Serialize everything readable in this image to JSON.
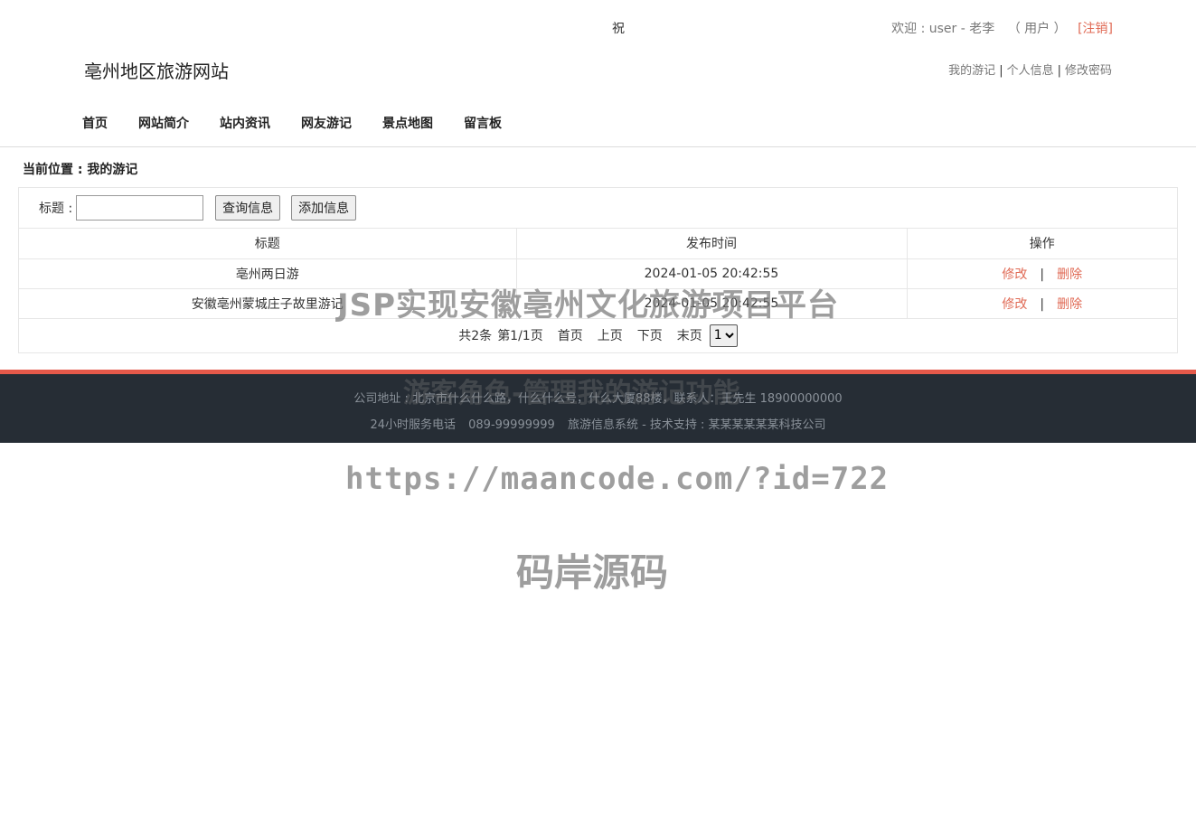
{
  "header": {
    "greeting": "祝",
    "welcome": {
      "prefix": "欢迎 : user - 老李",
      "role": "（ 用户 ）",
      "logout": "[注销]"
    },
    "site_title": "亳州地区旅游网站",
    "user_links": [
      {
        "label": "我的游记"
      },
      {
        "label": "个人信息"
      },
      {
        "label": "修改密码"
      }
    ],
    "link_separator": "|"
  },
  "nav": {
    "items": [
      {
        "label": "首页"
      },
      {
        "label": "网站简介"
      },
      {
        "label": "站内资讯"
      },
      {
        "label": "网友游记"
      },
      {
        "label": "景点地图"
      },
      {
        "label": "留言板"
      }
    ]
  },
  "breadcrumb": "当前位置 : 我的游记",
  "search": {
    "label": "标题 :",
    "value": "",
    "query_button": "查询信息",
    "add_button": "添加信息"
  },
  "table": {
    "headers": [
      "标题",
      "发布时间",
      "操作"
    ],
    "rows": [
      {
        "title": "亳州两日游",
        "time": "2024-01-05 20:42:55",
        "edit": "修改",
        "delete": "删除"
      },
      {
        "title": "安徽亳州蒙城庄子故里游记",
        "time": "2024-01-05 20:42:55",
        "edit": "修改",
        "delete": "删除"
      }
    ],
    "op_separator": "|"
  },
  "pager": {
    "summary": "共2条",
    "page_info": "第1/1页",
    "first": "首页",
    "prev": "上页",
    "next": "下页",
    "last": "末页",
    "selected_page": "1"
  },
  "footer": {
    "address": "公司地址 : 北京市什么什么路，什么什么号，什么大厦88楼，联系人：王先生 18900000000",
    "hotline": "24小时服务电话",
    "phone": "089-99999999",
    "system": "旅游信息系统 - 技术支持 : 某某某某某某科技公司"
  },
  "watermarks": {
    "line1": "JSP实现安徽亳州文化旅游项目平台",
    "line2": "游客角色-管理我的游记功能",
    "line3": "https://maancode.com/?id=722",
    "line4": "码岸源码"
  },
  "colors": {
    "accent": "#e06a55",
    "footer_bg": "#262d35",
    "footer_top_border": "#e5594a"
  }
}
